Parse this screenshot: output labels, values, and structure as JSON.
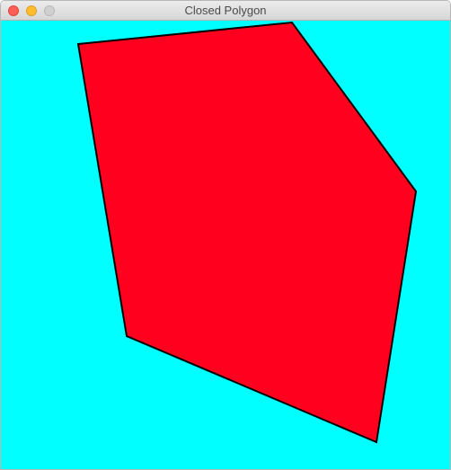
{
  "window": {
    "title": "Closed Polygon",
    "buttons": {
      "close_color": "#fe5f57",
      "close_border": "#e0443e",
      "minimize_color": "#febc2e",
      "minimize_border": "#dea123",
      "zoom_color": "#d0d0d0",
      "zoom_border": "#b8b8b8"
    }
  },
  "canvas": {
    "background_color": "#00ffff",
    "polygon": {
      "fill_color": "#ff001e",
      "stroke_color": "#000000",
      "closed": true
    }
  }
}
